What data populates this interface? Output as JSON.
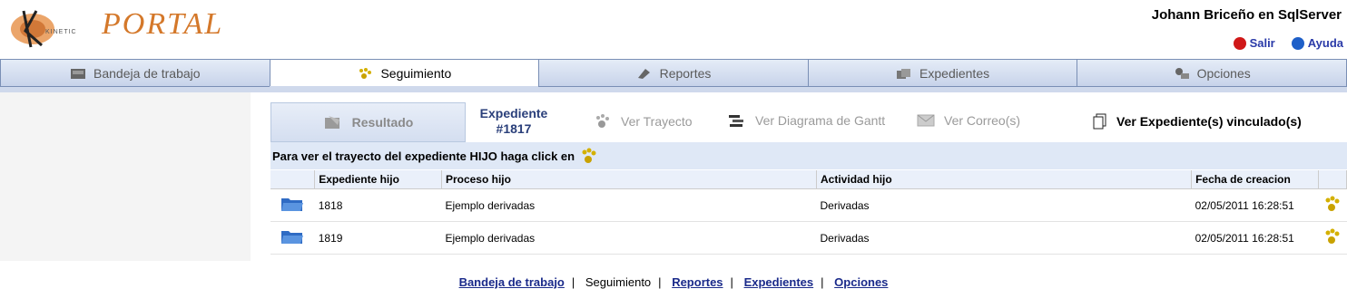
{
  "header": {
    "logo_small": "KINETIC",
    "logo_text": "PORTAL",
    "user": "Johann Briceño en SqlServer",
    "links": [
      {
        "label": "Salir",
        "icon": "power-icon",
        "color": "#d01818"
      },
      {
        "label": "Ayuda",
        "icon": "help-icon",
        "color": "#1e5fc8"
      }
    ]
  },
  "mainnav": {
    "tabs": [
      {
        "label": "Bandeja de trabajo",
        "icon": "inbox-icon"
      },
      {
        "label": "Seguimiento",
        "icon": "paw-icon"
      },
      {
        "label": "Reportes",
        "icon": "report-icon"
      },
      {
        "label": "Expedientes",
        "icon": "folders-icon"
      },
      {
        "label": "Opciones",
        "icon": "options-icon"
      }
    ],
    "active": "Seguimiento"
  },
  "subtabs": {
    "resultado": "Resultado",
    "expediente_line1": "Expediente",
    "expediente_line2": "#1817",
    "ver_trayecto": "Ver Trayecto",
    "ver_gantt": "Ver Diagrama de Gantt",
    "ver_correo": "Ver Correo(s)",
    "ver_vinculado": "Ver Expediente(s) vinculado(s)"
  },
  "info": "Para ver el trayecto del expediente HIJO haga click en",
  "table": {
    "headers": [
      "Expediente hijo",
      "Proceso hijo",
      "Actividad hijo",
      "Fecha de creacion"
    ],
    "rows": [
      {
        "expediente": "1818",
        "proceso": "Ejemplo derivadas",
        "actividad": "Derivadas",
        "fecha": "02/05/2011 16:28:51"
      },
      {
        "expediente": "1819",
        "proceso": "Ejemplo derivadas",
        "actividad": "Derivadas",
        "fecha": "02/05/2011 16:28:51"
      }
    ]
  },
  "footer": {
    "links": [
      "Bandeja de trabajo",
      "Seguimiento",
      "Reportes",
      "Expedientes",
      "Opciones"
    ],
    "separator": "|"
  },
  "colors": {
    "nav_bg": "#cfd9ec",
    "link": "#1a2a8a",
    "accent": "#d4782a"
  }
}
